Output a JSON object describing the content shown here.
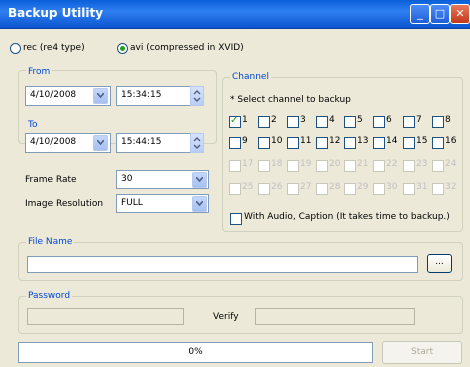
{
  "window": {
    "title": "Backup Utility"
  },
  "format": {
    "rec_label": "rec (re4 type)",
    "avi_label": "avi (compressed in XVID)",
    "selected": "avi"
  },
  "from": {
    "label": "From",
    "date": "4/10/2008",
    "time": "15:34:15"
  },
  "to": {
    "label": "To",
    "date": "4/10/2008",
    "time": "15:44:15"
  },
  "frame_rate": {
    "label": "Frame Rate",
    "value": "30"
  },
  "image_resolution": {
    "label": "Image Resolution",
    "value": "FULL"
  },
  "channel": {
    "label": "Channel",
    "hint": "* Select channel to backup",
    "items": [
      {
        "label": "1",
        "checked": true,
        "enabled": true
      },
      {
        "label": "2",
        "checked": false,
        "enabled": true
      },
      {
        "label": "3",
        "checked": false,
        "enabled": true
      },
      {
        "label": "4",
        "checked": false,
        "enabled": true
      },
      {
        "label": "5",
        "checked": false,
        "enabled": true
      },
      {
        "label": "6",
        "checked": false,
        "enabled": true
      },
      {
        "label": "7",
        "checked": false,
        "enabled": true
      },
      {
        "label": "8",
        "checked": false,
        "enabled": true
      },
      {
        "label": "9",
        "checked": false,
        "enabled": true
      },
      {
        "label": "10",
        "checked": false,
        "enabled": true
      },
      {
        "label": "11",
        "checked": false,
        "enabled": true
      },
      {
        "label": "12",
        "checked": false,
        "enabled": true
      },
      {
        "label": "13",
        "checked": false,
        "enabled": true
      },
      {
        "label": "14",
        "checked": false,
        "enabled": true
      },
      {
        "label": "15",
        "checked": false,
        "enabled": true
      },
      {
        "label": "16",
        "checked": false,
        "enabled": true
      },
      {
        "label": "17",
        "checked": false,
        "enabled": false
      },
      {
        "label": "18",
        "checked": false,
        "enabled": false
      },
      {
        "label": "19",
        "checked": false,
        "enabled": false
      },
      {
        "label": "20",
        "checked": false,
        "enabled": false
      },
      {
        "label": "21",
        "checked": false,
        "enabled": false
      },
      {
        "label": "22",
        "checked": false,
        "enabled": false
      },
      {
        "label": "23",
        "checked": false,
        "enabled": false
      },
      {
        "label": "24",
        "checked": false,
        "enabled": false
      },
      {
        "label": "25",
        "checked": false,
        "enabled": false
      },
      {
        "label": "26",
        "checked": false,
        "enabled": false
      },
      {
        "label": "27",
        "checked": false,
        "enabled": false
      },
      {
        "label": "28",
        "checked": false,
        "enabled": false
      },
      {
        "label": "29",
        "checked": false,
        "enabled": false
      },
      {
        "label": "30",
        "checked": false,
        "enabled": false
      },
      {
        "label": "31",
        "checked": false,
        "enabled": false
      },
      {
        "label": "32",
        "checked": false,
        "enabled": false
      }
    ],
    "audio_caption_label": "With Audio, Caption (It takes time to backup.)",
    "audio_caption_checked": false
  },
  "file_name": {
    "label": "File Name",
    "value": "",
    "browse_label": "..."
  },
  "password": {
    "label": "Password",
    "value": "",
    "verify_label": "Verify",
    "verify_value": ""
  },
  "progress": {
    "text": "0%",
    "value": 0
  },
  "start_button": {
    "label": "Start",
    "enabled": false
  },
  "colors": {
    "accent": "#0046d5",
    "titlebar": "#0a5fd8"
  }
}
